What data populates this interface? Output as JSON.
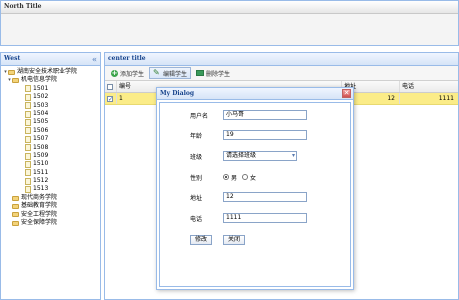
{
  "north": {
    "title": "North Title"
  },
  "west": {
    "title": "West",
    "collapse_icon": "double-chevron-left-icon"
  },
  "center": {
    "title": "center title"
  },
  "tree": {
    "root": "湖南安全技术职业学院",
    "dept": "机电信息学院",
    "classes": [
      "1501",
      "1502",
      "1503",
      "1504",
      "1505",
      "1506",
      "1507",
      "1508",
      "1509",
      "1510",
      "1511",
      "1512",
      "1513"
    ],
    "others": [
      "现代商务学院",
      "基础教育学院",
      "安全工程学院",
      "安全保障学院"
    ]
  },
  "toolbar": {
    "add": "添加学生",
    "edit": "编辑学生",
    "delete": "删除学生"
  },
  "grid": {
    "headers": [
      "编号",
      "地址",
      "电话"
    ],
    "rows": [
      {
        "id": "1",
        "address": "12",
        "phone": "1111"
      }
    ]
  },
  "dialog": {
    "title": "My Dialog",
    "close_icon": "close-icon",
    "labels": {
      "username": "用户名",
      "age": "年龄",
      "class": "班级",
      "gender": "性别",
      "address": "地址",
      "phone": "电话"
    },
    "values": {
      "username": "小马哥",
      "age": "19",
      "class": "请选择班级",
      "address": "12",
      "phone": "1111"
    },
    "gender_options": [
      "男",
      "女"
    ],
    "gender_selected": "男",
    "buttons": {
      "edit": "修改",
      "close": "关闭"
    }
  },
  "colors": {
    "border": "#99bbe8",
    "header_text": "#15428b",
    "selected_row": "#fbec88"
  }
}
